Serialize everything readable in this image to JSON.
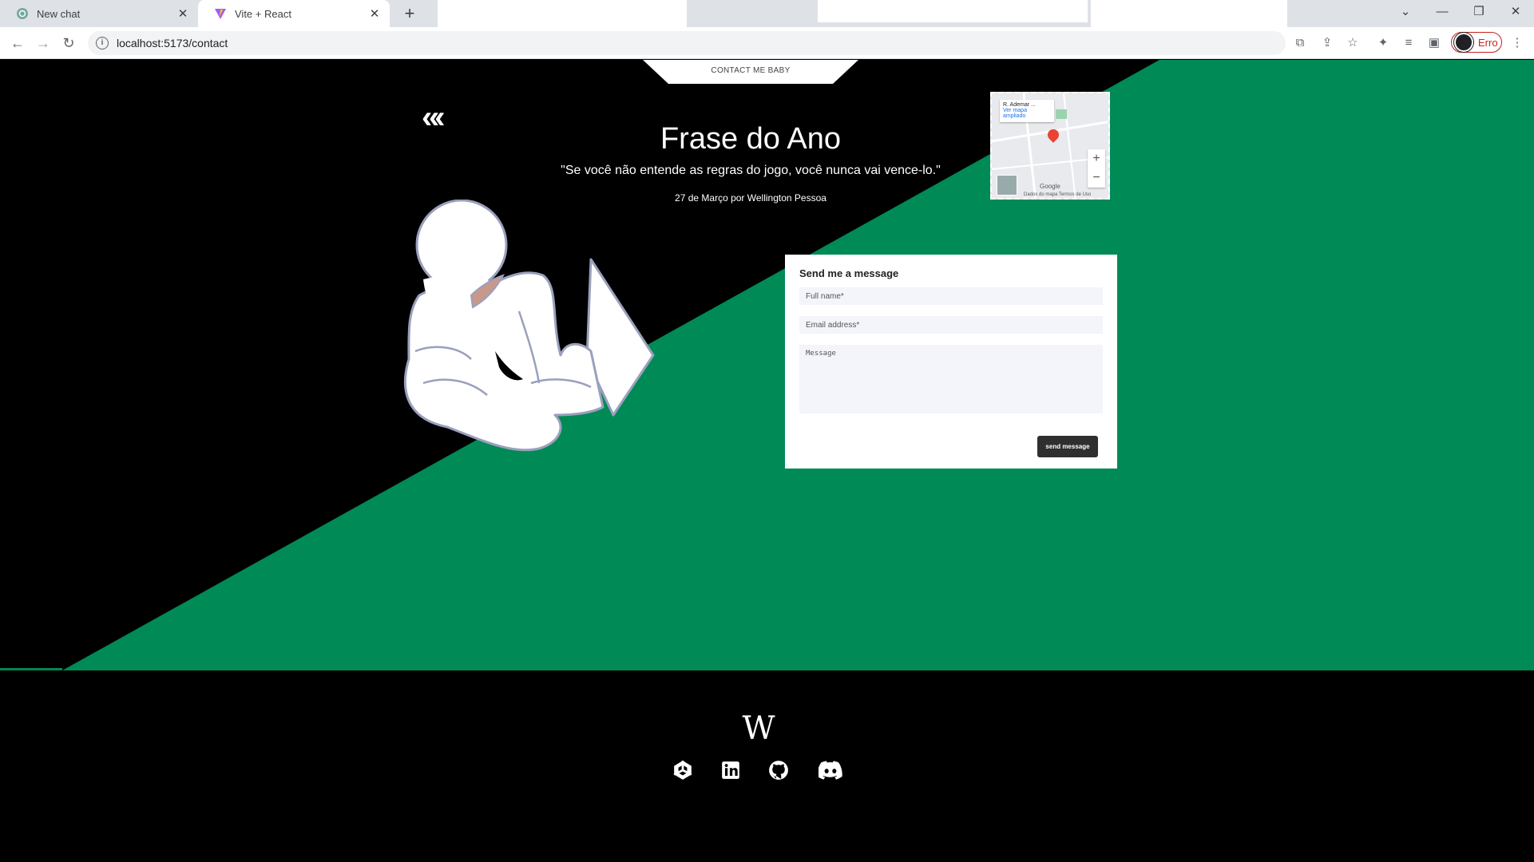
{
  "browser": {
    "tabs": [
      {
        "title": "New chat",
        "active": false,
        "favicon": "chatgpt-icon"
      },
      {
        "title": "Vite + React",
        "active": true,
        "favicon": "vite-icon"
      }
    ],
    "url": "localhost:5173/contact",
    "profile_label": "Erro"
  },
  "page": {
    "nav_label": "CONTACT ME BABY",
    "back_icon": "triple-chevron-left-icon",
    "quote": {
      "title": "Frase do Ano",
      "text": "\"Se você não entende as regras do jogo, você nunca vai vence-lo.\"",
      "meta": "27 de Março por Wellington Pessoa"
    },
    "map": {
      "place": "R. Ademar ...",
      "link": "Ver mapa ampliado",
      "brand": "Google",
      "footer": "Dados do mapa  Termos de Uso",
      "zoom_in": "+",
      "zoom_out": "−"
    },
    "form": {
      "title": "Send me a message",
      "name_placeholder": "Full name*",
      "email_placeholder": "Email address*",
      "message_placeholder": "Message",
      "submit": "send message"
    },
    "footer": {
      "logo": "W",
      "socials": [
        "unity-icon",
        "linkedin-icon",
        "github-icon",
        "discord-icon"
      ]
    },
    "colors": {
      "green": "#008a55",
      "black": "#000000"
    }
  }
}
